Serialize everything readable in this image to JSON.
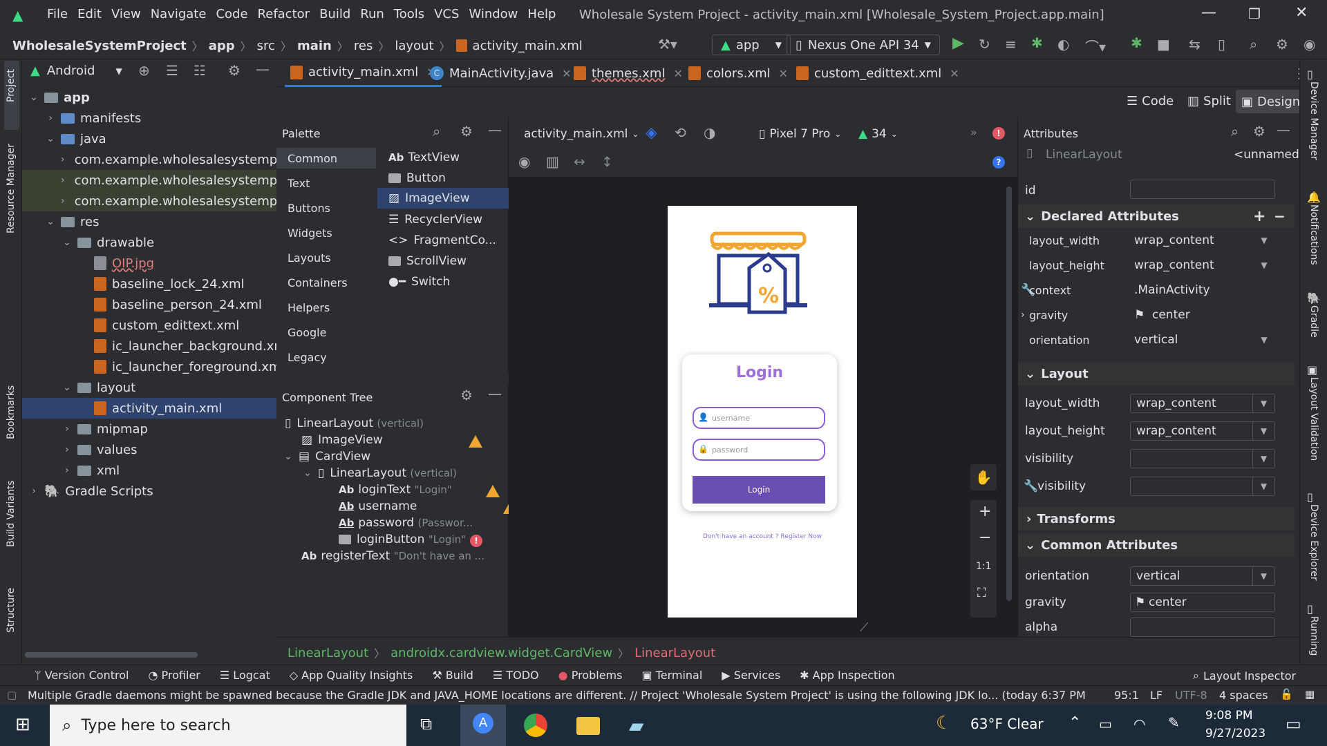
{
  "window": {
    "title": "Wholesale System Project - activity_main.xml [Wholesale_System_Project.app.main]",
    "menu": [
      "File",
      "Edit",
      "View",
      "Navigate",
      "Code",
      "Refactor",
      "Build",
      "Run",
      "Tools",
      "VCS",
      "Window",
      "Help"
    ]
  },
  "breadcrumb": {
    "project": "WholesaleSystemProject",
    "items": [
      "app",
      "src",
      "main",
      "res",
      "layout",
      "activity_main.xml"
    ]
  },
  "toolbar": {
    "run_config": "app",
    "device": "Nexus One API 34"
  },
  "project_panel": {
    "label": "Project",
    "view_mode": "Android",
    "tree": [
      {
        "label": "app",
        "bold": true
      },
      {
        "label": "manifests"
      },
      {
        "label": "java"
      },
      {
        "label": "com.example.wholesalesystemp"
      },
      {
        "label": "com.example.wholesalesystemp"
      },
      {
        "label": "com.example.wholesalesystemp"
      },
      {
        "label": "res"
      },
      {
        "label": "drawable"
      },
      {
        "label": "OIP.jpg"
      },
      {
        "label": "baseline_lock_24.xml"
      },
      {
        "label": "baseline_person_24.xml"
      },
      {
        "label": "custom_edittext.xml"
      },
      {
        "label": "ic_launcher_background.xml"
      },
      {
        "label": "ic_launcher_foreground.xml"
      },
      {
        "label": "layout"
      },
      {
        "label": "activity_main.xml"
      },
      {
        "label": "mipmap"
      },
      {
        "label": "values"
      },
      {
        "label": "xml"
      },
      {
        "label": "Gradle Scripts"
      }
    ]
  },
  "left_strip": [
    "Project",
    "Resource Manager",
    "Bookmarks",
    "Build Variants",
    "Structure"
  ],
  "right_strip": [
    "Device Manager",
    "Notifications",
    "Gradle",
    "Layout Validation",
    "Device Explorer",
    "Running"
  ],
  "editor_tabs": [
    "activity_main.xml",
    "MainActivity.java",
    "themes.xml",
    "colors.xml",
    "custom_edittext.xml"
  ],
  "view_modes": [
    "Code",
    "Split",
    "Design"
  ],
  "palette": {
    "title": "Palette",
    "categories": [
      "Common",
      "Text",
      "Buttons",
      "Widgets",
      "Layouts",
      "Containers",
      "Helpers",
      "Google",
      "Legacy"
    ],
    "items": [
      "TextView",
      "Button",
      "ImageView",
      "RecyclerView",
      "FragmentCo...",
      "ScrollView",
      "Switch"
    ],
    "textview_prefix": "Ab"
  },
  "component_tree": {
    "title": "Component Tree",
    "rows": [
      {
        "name": "LinearLayout",
        "hint": "(vertical)"
      },
      {
        "name": "ImageView",
        "hint": ""
      },
      {
        "name": "CardView",
        "hint": ""
      },
      {
        "name": "LinearLayout",
        "hint": "(vertical)"
      },
      {
        "name": "loginText",
        "hint": "\"Login\""
      },
      {
        "name": "username",
        "hint": ""
      },
      {
        "name": "password",
        "hint": "(Passwor..."
      },
      {
        "name": "loginButton",
        "hint": "\"Login\""
      },
      {
        "name": "registerText",
        "hint": "\"Don't have an ..."
      }
    ]
  },
  "design_toolbar": {
    "file": "activity_main.xml",
    "device": "Pixel 7 Pro",
    "api": "34",
    "zoom_fit": "1:1"
  },
  "preview": {
    "card_title": "Login",
    "username_hint": "username",
    "password_hint": "password",
    "button_label": "Login",
    "register_text": "Don't have an account ? Register Now"
  },
  "attributes": {
    "title": "Attributes",
    "component": "LinearLayout",
    "component_name": "<unnamed>",
    "id_label": "id",
    "declared_title": "Declared Attributes",
    "declared": [
      {
        "name": "layout_width",
        "value": "wrap_content"
      },
      {
        "name": "layout_height",
        "value": "wrap_content"
      },
      {
        "name": "context",
        "value": ".MainActivity"
      },
      {
        "name": "gravity",
        "value": "center"
      },
      {
        "name": "orientation",
        "value": "vertical"
      }
    ],
    "layout_title": "Layout",
    "layout": [
      {
        "name": "layout_width",
        "value": "wrap_content"
      },
      {
        "name": "layout_height",
        "value": "wrap_content"
      },
      {
        "name": "visibility",
        "value": ""
      },
      {
        "name": "visibility",
        "value": ""
      }
    ],
    "transforms_title": "Transforms",
    "common_title": "Common Attributes",
    "common": [
      {
        "name": "orientation",
        "value": "vertical"
      },
      {
        "name": "gravity",
        "value": "center"
      },
      {
        "name": "alpha",
        "value": ""
      }
    ]
  },
  "bottom_breadcrumb": [
    "LinearLayout",
    "androidx.cardview.widget.CardView",
    "LinearLayout"
  ],
  "tool_windows": [
    "Version Control",
    "Profiler",
    "Logcat",
    "App Quality Insights",
    "Build",
    "TODO",
    "Problems",
    "Terminal",
    "Services",
    "App Inspection"
  ],
  "layout_inspector": "Layout Inspector",
  "status": {
    "message": "Multiple Gradle daemons might be spawned because the Gradle JDK and JAVA_HOME locations are different. // Project 'Wholesale System Project' is using the following JDK lo... (today 6:37 PM",
    "position": "95:1",
    "line_sep": "LF",
    "encoding": "UTF-8",
    "indent": "4 spaces"
  },
  "taskbar": {
    "search_placeholder": "Type here to search",
    "weather": "63°F  Clear",
    "time": "9:08 PM",
    "date": "9/27/2023"
  },
  "colors": {
    "accent": "#3574f0",
    "login_purple": "#6a4fb3",
    "login_title": "#9b6fd6",
    "warning": "#f0a732",
    "error": "#e55765"
  }
}
